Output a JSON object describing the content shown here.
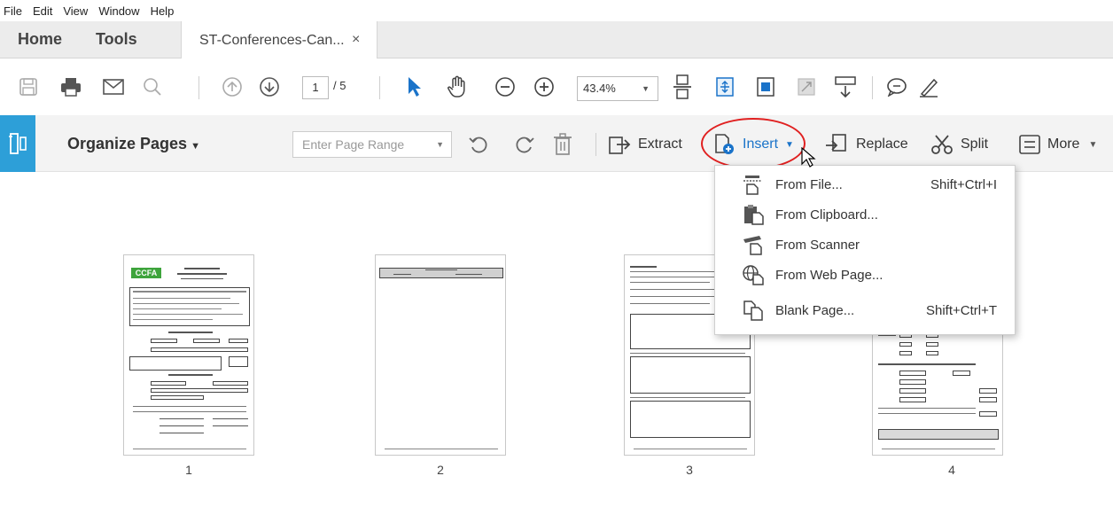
{
  "menubar": {
    "items": [
      "File",
      "Edit",
      "View",
      "Window",
      "Help"
    ]
  },
  "tabs": {
    "home": "Home",
    "tools": "Tools",
    "document": "ST-Conferences-Can...",
    "close": "×"
  },
  "toolbar": {
    "current_page": "1",
    "page_of": "/ 5",
    "zoom": "43.4%"
  },
  "organize": {
    "title": "Organize Pages",
    "range_placeholder": "Enter Page Range",
    "extract": "Extract",
    "insert": "Insert",
    "replace": "Replace",
    "split": "Split",
    "more": "More"
  },
  "insert_menu": {
    "items": [
      {
        "label": "From File...",
        "shortcut": "Shift+Ctrl+I",
        "icon": "file-insert-icon"
      },
      {
        "label": "From Clipboard...",
        "shortcut": "",
        "icon": "clipboard-icon"
      },
      {
        "label": "From Scanner",
        "shortcut": "",
        "icon": "scanner-icon"
      },
      {
        "label": "From Web Page...",
        "shortcut": "",
        "icon": "web-page-icon"
      },
      {
        "label": "Blank Page...",
        "shortcut": "Shift+Ctrl+T",
        "icon": "blank-page-icon"
      }
    ]
  },
  "pages": {
    "labels": [
      "1",
      "2",
      "3",
      "4"
    ],
    "page1_logo": "CCFA"
  },
  "colors": {
    "accent": "#2d9fd8",
    "highlight": "#e02020",
    "logo_green": "#3ea43c"
  }
}
